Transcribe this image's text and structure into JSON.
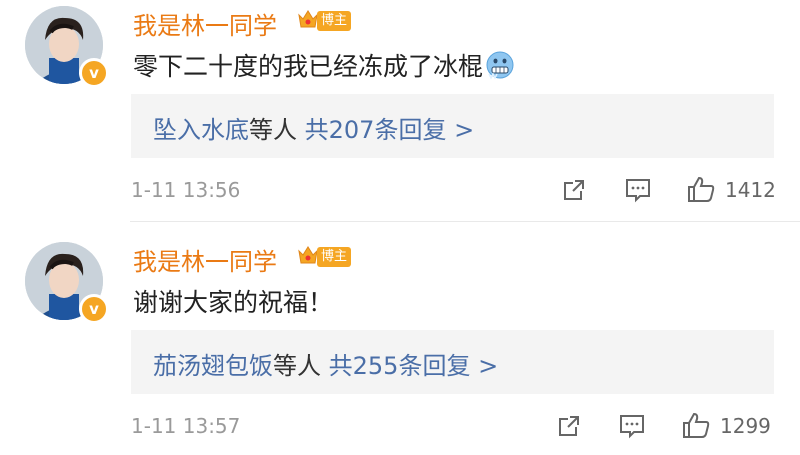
{
  "comments": [
    {
      "username": "我是林一同学",
      "role_badge": "博主",
      "text": "零下二十度的我已经冻成了冰棍",
      "emoji": "freezing-face-icon",
      "replies": {
        "names": "坠入水底",
        "middle": "等人",
        "summary": "共207条回复 >"
      },
      "time": "1-11 13:56",
      "likes": "1412"
    },
    {
      "username": "我是林一同学",
      "role_badge": "博主",
      "text": "谢谢大家的祝福！",
      "replies": {
        "names": "茄汤翅包饭",
        "middle": "等人",
        "summary": "共255条回复 >"
      },
      "time": "1-11 13:57",
      "likes": "1299"
    }
  ],
  "colors": {
    "username": "#ea7a14",
    "link": "#4a6ea7",
    "badge": "#f5a623",
    "reply_bg": "#f4f4f4"
  }
}
